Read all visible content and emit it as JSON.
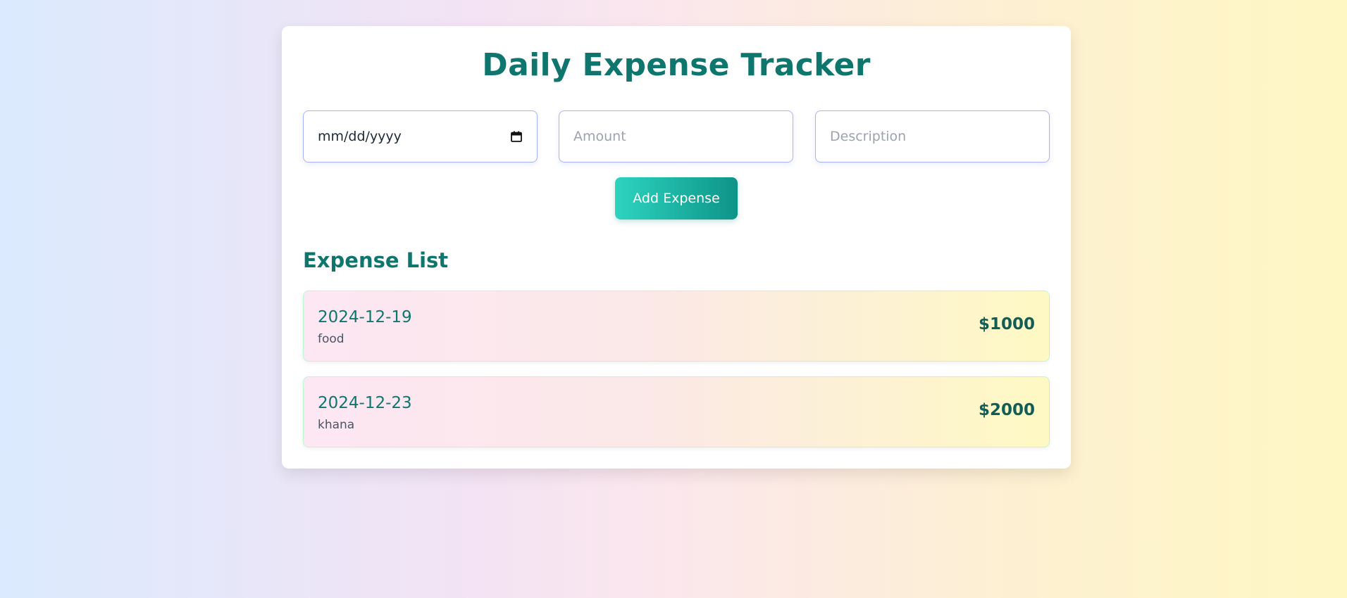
{
  "app": {
    "title": "Daily Expense Tracker"
  },
  "form": {
    "date_placeholder": "mm/dd/yyyy",
    "amount_placeholder": "Amount",
    "description_placeholder": "Description",
    "add_button_label": "Add Expense"
  },
  "expense_list": {
    "heading": "Expense List",
    "items": [
      {
        "date": "2024-12-19",
        "description": "food",
        "amount": "$1000"
      },
      {
        "date": "2024-12-23",
        "description": "khana",
        "amount": "$2000"
      }
    ]
  },
  "icons": {
    "date_field": "calendar-icon"
  },
  "colors": {
    "accent": "#0f766e",
    "button_start": "#2dd4bf",
    "button_end": "#0d9488",
    "input_border": "#a5b4fc",
    "item_border": "#bbf7d0"
  }
}
